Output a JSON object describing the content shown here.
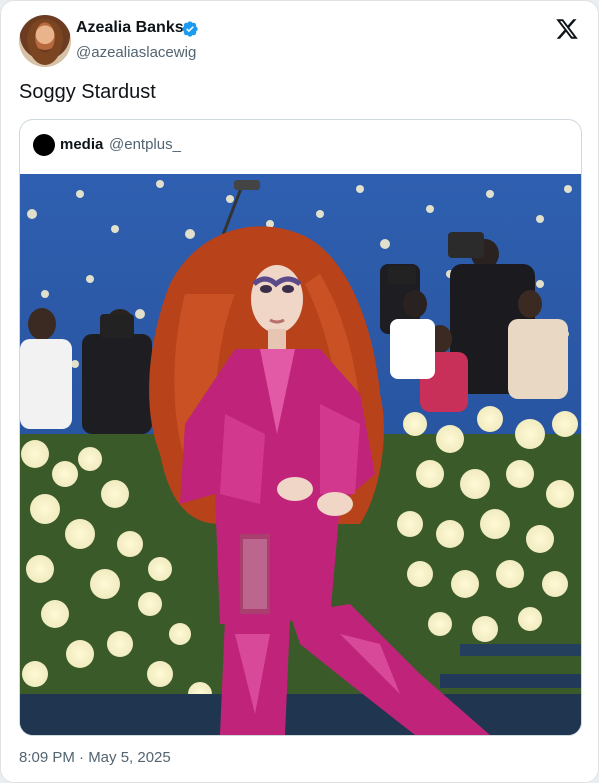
{
  "author": {
    "display_name": "Azealia Banks",
    "handle": "@azealiaslacewig",
    "verified": true
  },
  "tweet": {
    "text": "Soggy Stardust",
    "timestamp": "8:09 PM · May 5, 2025"
  },
  "quoted": {
    "name": "media",
    "handle": "@entplus_"
  },
  "icons": {
    "verified": "verified-badge-icon",
    "platform": "x-logo-icon"
  },
  "colors": {
    "verified_blue": "#1d9bf0",
    "text_primary": "#0f1419",
    "text_secondary": "#536471"
  }
}
